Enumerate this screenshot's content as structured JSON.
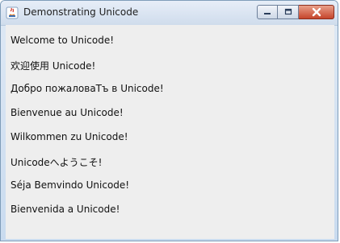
{
  "window": {
    "title": "Demonstrating Unicode",
    "controls": {
      "minimize_icon": "minimize-icon",
      "maximize_icon": "maximize-icon",
      "close_icon": "close-icon"
    },
    "colors": {
      "title_bar": "#d6e2f1",
      "content_bg": "#eeeeee",
      "close_button": "#c5452c"
    }
  },
  "greetings": [
    "Welcome to Unicode!",
    "欢迎使用  Unicode!",
    "Добро пожаловаТъ в Unicode!",
    "Bienvenue au Unicode!",
    "Wilkommen zu Unicode!",
    "Unicodeへようこそ!",
    "Séja Bemvindo Unicode!",
    "Bienvenida a Unicode!"
  ]
}
